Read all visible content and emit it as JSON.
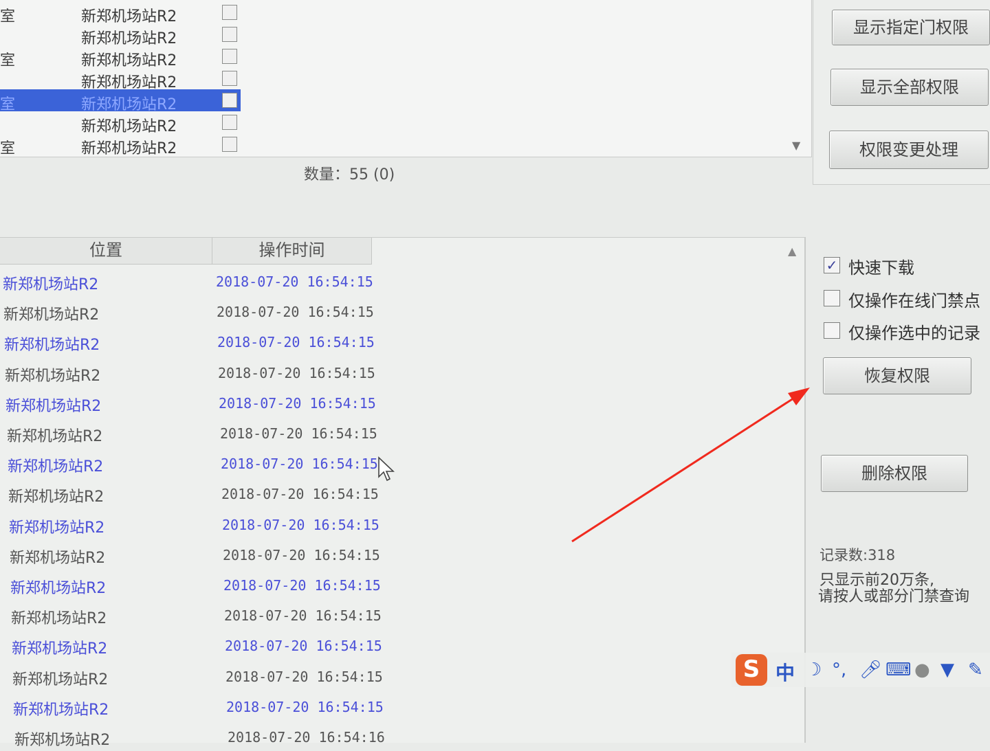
{
  "top_list": {
    "rows": [
      {
        "prefix": "室",
        "name": "新郑机场站R2",
        "selected": false
      },
      {
        "prefix": "",
        "name": "新郑机场站R2",
        "selected": false
      },
      {
        "prefix": "室",
        "name": "新郑机场站R2",
        "selected": false
      },
      {
        "prefix": "",
        "name": "新郑机场站R2",
        "selected": false
      },
      {
        "prefix": "室",
        "name": "新郑机场站R2",
        "selected": true
      },
      {
        "prefix": "",
        "name": "新郑机场站R2",
        "selected": false
      },
      {
        "prefix": "室",
        "name": "新郑机场站R2",
        "selected": false
      }
    ],
    "count_label": "数量：55 (0)"
  },
  "right_top": {
    "show_door_button": "显示指定门权限",
    "show_all_button": "显示全部权限",
    "perm_change_button": "权限变更处理"
  },
  "bottom_table": {
    "headers": {
      "location": "位置",
      "op_time": "操作时间"
    },
    "rows": [
      {
        "location": "新郑机场站R2",
        "time": "2018-07-20 16:54:15"
      },
      {
        "location": "新郑机场站R2",
        "time": "2018-07-20 16:54:15"
      },
      {
        "location": "新郑机场站R2",
        "time": "2018-07-20 16:54:15"
      },
      {
        "location": "新郑机场站R2",
        "time": "2018-07-20 16:54:15"
      },
      {
        "location": "新郑机场站R2",
        "time": "2018-07-20 16:54:15"
      },
      {
        "location": "新郑机场站R2",
        "time": "2018-07-20 16:54:15"
      },
      {
        "location": "新郑机场站R2",
        "time": "2018-07-20 16:54:15"
      },
      {
        "location": "新郑机场站R2",
        "time": "2018-07-20 16:54:15"
      },
      {
        "location": "新郑机场站R2",
        "time": "2018-07-20 16:54:15"
      },
      {
        "location": "新郑机场站R2",
        "time": "2018-07-20 16:54:15"
      },
      {
        "location": "新郑机场站R2",
        "time": "2018-07-20 16:54:15"
      },
      {
        "location": "新郑机场站R2",
        "time": "2018-07-20 16:54:15"
      },
      {
        "location": "新郑机场站R2",
        "time": "2018-07-20 16:54:15"
      },
      {
        "location": "新郑机场站R2",
        "time": "2018-07-20 16:54:15"
      },
      {
        "location": "新郑机场站R2",
        "time": "2018-07-20 16:54:15"
      },
      {
        "location": "新郑机场站R2",
        "time": "2018-07-20 16:54:16"
      }
    ]
  },
  "options": {
    "fast_download": {
      "label": "快速下载",
      "checked": true
    },
    "online_only": {
      "label": "仅操作在线门禁点",
      "checked": false
    },
    "selected_only": {
      "label": "仅操作选中的记录",
      "checked": false
    }
  },
  "actions": {
    "restore_button": "恢复权限",
    "delete_button": "删除权限"
  },
  "footer_info": {
    "record_count": "记录数:318",
    "notice_line1": "只显示前20万条,",
    "notice_line2": "请按人或部分门禁查询"
  },
  "ime_toolbar": {
    "logo": "S",
    "lang": "中",
    "icons": [
      "moon-icon",
      "punctuation-icon",
      "microphone-icon",
      "keyboard-icon",
      "user-icon",
      "shirt-icon",
      "wrench-icon"
    ]
  },
  "colors": {
    "selected_row": "#3b63d8",
    "link_blue": "#4a4fd8",
    "annotation_arrow": "#f02a1e",
    "ime_logo": "#e8622c"
  }
}
